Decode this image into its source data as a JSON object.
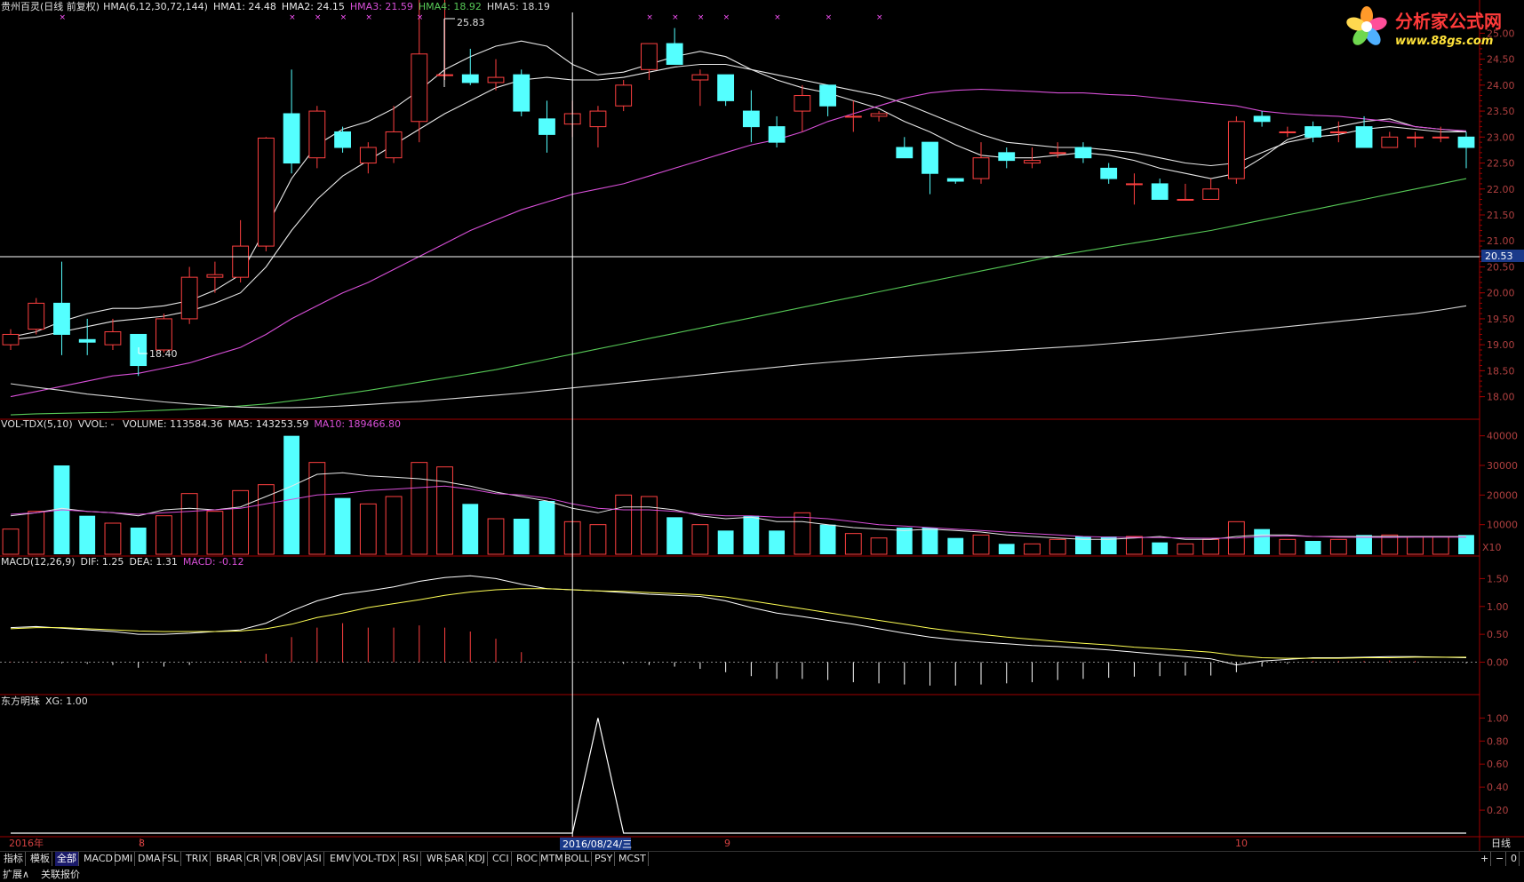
{
  "colors": {
    "bg": "#000000",
    "up": "#ff4040",
    "down": "#54ffff",
    "frame": "#a00000",
    "axis_text": "#b04040",
    "white": "#ffffff",
    "yellow": "#ffff54",
    "magenta": "#ff54ff",
    "green": "#54ff54",
    "hma1": "#e8e8e8",
    "hma2": "#e8e8e8",
    "hma3": "#d84fd8",
    "hma4": "#56c856",
    "hma5": "#d8d8d8",
    "vol_ma5": "#e8e8e8",
    "vol_ma10": "#d84fd8"
  },
  "header": {
    "stock": "贵州百灵(日线 前复权)",
    "indicator": "HMA(6,12,30,72,144)",
    "hma1": "HMA1: 24.48",
    "hma2": "HMA2: 24.15",
    "hma3": "HMA3: 21.59",
    "hma4": "HMA4: 18.92",
    "hma5": "HMA5: 18.19"
  },
  "vol_header": {
    "name": "VOL-TDX(5,10)",
    "vvol": "VVOL: -",
    "volume": "VOLUME: 113584.36",
    "ma5": "MA5: 143253.59",
    "ma10": "MA10: 189466.80"
  },
  "macd_header": {
    "name": "MACD(12,26,9)",
    "dif": "DIF: 1.25",
    "dea": "DEA: 1.31",
    "macd": "MACD: -0.12"
  },
  "xg_header": {
    "name": "东方明珠",
    "xg": "XG: 1.00"
  },
  "logo": {
    "title": "分析家公式网",
    "url": "www.88gs.com"
  },
  "price_annotations": {
    "high": "25.83",
    "low": "18.40",
    "current": "20.53"
  },
  "price_axis": [
    "25.00",
    "24.50",
    "24.00",
    "23.50",
    "23.00",
    "22.50",
    "22.00",
    "21.50",
    "21.00",
    "20.50",
    "20.00",
    "19.50",
    "19.00",
    "18.50",
    "18.00"
  ],
  "vol_axis": [
    "40000",
    "30000",
    "20000",
    "10000"
  ],
  "vol_unit": "X10",
  "macd_axis": [
    "1.50",
    "1.00",
    "0.50",
    "0.00"
  ],
  "xg_axis": [
    "1.00",
    "0.80",
    "0.60",
    "0.40",
    "0.20"
  ],
  "date_labels": {
    "year": "2016年",
    "m8": "8",
    "cursor": "2016/08/24/三",
    "m9": "9",
    "m10": "10",
    "period": "日线"
  },
  "tabs": [
    "指标",
    "模板",
    "全部",
    "MACD",
    "DMI",
    "DMA",
    "FSL",
    "TRIX",
    "BRAR",
    "CR",
    "VR",
    "OBV",
    "ASI",
    "EMV",
    "VOL-TDX",
    "RSI",
    "WR",
    "SAR",
    "KDJ",
    "CCI",
    "ROC",
    "MTM",
    "BOLL",
    "PSY",
    "MCST"
  ],
  "tab_controls": [
    "+",
    "−",
    "0"
  ],
  "bottom": {
    "expand": "扩展∧",
    "linked": "关联报价"
  },
  "chart_data": {
    "type": "candlestick",
    "price_range": [
      17.6,
      25.4
    ],
    "candles": [
      {
        "o": 19.0,
        "c": 19.2,
        "h": 19.3,
        "l": 18.9
      },
      {
        "o": 19.3,
        "c": 19.8,
        "h": 19.9,
        "l": 19.2
      },
      {
        "o": 19.8,
        "c": 19.2,
        "h": 20.6,
        "l": 18.8
      },
      {
        "o": 19.1,
        "c": 19.05,
        "h": 19.5,
        "l": 18.8
      },
      {
        "o": 19.0,
        "c": 19.25,
        "h": 19.5,
        "l": 18.9
      },
      {
        "o": 19.2,
        "c": 18.6,
        "h": 19.2,
        "l": 18.4
      },
      {
        "o": 18.9,
        "c": 19.5,
        "h": 19.6,
        "l": 18.85
      },
      {
        "o": 19.5,
        "c": 20.3,
        "h": 20.5,
        "l": 19.4
      },
      {
        "o": 20.3,
        "c": 20.35,
        "h": 20.6,
        "l": 20.0
      },
      {
        "o": 20.3,
        "c": 20.9,
        "h": 21.4,
        "l": 20.2
      },
      {
        "o": 20.9,
        "c": 22.98,
        "h": 23.0,
        "l": 20.8
      },
      {
        "o": 23.45,
        "c": 22.5,
        "h": 24.3,
        "l": 22.3
      },
      {
        "o": 22.6,
        "c": 23.5,
        "h": 23.6,
        "l": 22.4
      },
      {
        "o": 23.1,
        "c": 22.8,
        "h": 23.2,
        "l": 22.7
      },
      {
        "o": 22.5,
        "c": 22.8,
        "h": 22.9,
        "l": 22.3
      },
      {
        "o": 22.6,
        "c": 23.1,
        "h": 23.6,
        "l": 22.5
      },
      {
        "o": 23.3,
        "c": 24.6,
        "h": 25.7,
        "l": 22.9
      },
      {
        "o": 24.2,
        "c": 24.2,
        "h": 25.83,
        "l": 24.1
      },
      {
        "o": 24.2,
        "c": 24.05,
        "h": 24.7,
        "l": 24.0
      },
      {
        "o": 24.05,
        "c": 24.15,
        "h": 24.5,
        "l": 23.9
      },
      {
        "o": 24.2,
        "c": 23.5,
        "h": 24.3,
        "l": 23.4
      },
      {
        "o": 23.35,
        "c": 23.05,
        "h": 23.7,
        "l": 22.7
      },
      {
        "o": 23.25,
        "c": 23.45,
        "h": 23.7,
        "l": 23.0
      },
      {
        "o": 23.2,
        "c": 23.5,
        "h": 23.6,
        "l": 22.8
      },
      {
        "o": 23.6,
        "c": 24.0,
        "h": 24.1,
        "l": 23.5
      },
      {
        "o": 24.3,
        "c": 24.8,
        "h": 24.8,
        "l": 24.1
      },
      {
        "o": 24.8,
        "c": 24.4,
        "h": 25.1,
        "l": 24.4
      },
      {
        "o": 24.1,
        "c": 24.2,
        "h": 24.3,
        "l": 23.6
      },
      {
        "o": 24.2,
        "c": 23.7,
        "h": 24.2,
        "l": 23.6
      },
      {
        "o": 23.5,
        "c": 23.2,
        "h": 23.9,
        "l": 22.9
      },
      {
        "o": 23.2,
        "c": 22.9,
        "h": 23.4,
        "l": 22.8
      },
      {
        "o": 23.5,
        "c": 23.8,
        "h": 24.0,
        "l": 23.1
      },
      {
        "o": 24.0,
        "c": 23.6,
        "h": 24.0,
        "l": 23.4
      },
      {
        "o": 23.4,
        "c": 23.4,
        "h": 23.7,
        "l": 23.1
      },
      {
        "o": 23.4,
        "c": 23.45,
        "h": 23.5,
        "l": 23.3
      },
      {
        "o": 22.8,
        "c": 22.6,
        "h": 23.0,
        "l": 22.6
      },
      {
        "o": 22.9,
        "c": 22.3,
        "h": 22.9,
        "l": 21.9
      },
      {
        "o": 22.2,
        "c": 22.15,
        "h": 22.2,
        "l": 22.1
      },
      {
        "o": 22.2,
        "c": 22.6,
        "h": 22.9,
        "l": 22.1
      },
      {
        "o": 22.7,
        "c": 22.55,
        "h": 22.8,
        "l": 22.4
      },
      {
        "o": 22.5,
        "c": 22.55,
        "h": 22.8,
        "l": 22.4
      },
      {
        "o": 22.7,
        "c": 22.7,
        "h": 22.9,
        "l": 22.6
      },
      {
        "o": 22.8,
        "c": 22.6,
        "h": 22.9,
        "l": 22.5
      },
      {
        "o": 22.4,
        "c": 22.2,
        "h": 22.5,
        "l": 22.1
      },
      {
        "o": 22.1,
        "c": 22.1,
        "h": 22.3,
        "l": 21.7
      },
      {
        "o": 22.1,
        "c": 21.8,
        "h": 22.2,
        "l": 21.8
      },
      {
        "o": 21.8,
        "c": 21.8,
        "h": 22.1,
        "l": 21.8
      },
      {
        "o": 21.8,
        "c": 22.0,
        "h": 22.2,
        "l": 21.8
      },
      {
        "o": 22.2,
        "c": 23.3,
        "h": 23.4,
        "l": 22.1
      },
      {
        "o": 23.4,
        "c": 23.3,
        "h": 23.5,
        "l": 23.2
      },
      {
        "o": 23.1,
        "c": 23.1,
        "h": 23.2,
        "l": 23.0
      },
      {
        "o": 23.2,
        "c": 23.0,
        "h": 23.3,
        "l": 22.9
      },
      {
        "o": 23.1,
        "c": 23.1,
        "h": 23.3,
        "l": 22.9
      },
      {
        "o": 23.2,
        "c": 22.8,
        "h": 23.4,
        "l": 22.8
      },
      {
        "o": 22.8,
        "c": 23.0,
        "h": 23.1,
        "l": 22.8
      },
      {
        "o": 23.0,
        "c": 23.0,
        "h": 23.1,
        "l": 22.8
      },
      {
        "o": 23.0,
        "c": 23.0,
        "h": 23.2,
        "l": 22.9
      },
      {
        "o": 23.0,
        "c": 22.8,
        "h": 23.1,
        "l": 22.4
      }
    ],
    "hma_series": [
      {
        "values": [
          19.15,
          19.25,
          19.45,
          19.6,
          19.7,
          19.7,
          19.75,
          19.85,
          20.05,
          20.35,
          21.25,
          22.2,
          22.85,
          23.15,
          23.3,
          23.55,
          23.9,
          24.3,
          24.55,
          24.75,
          24.85,
          24.75,
          24.4,
          24.2,
          24.25,
          24.4,
          24.55,
          24.65,
          24.55,
          24.3,
          24.1,
          23.95,
          23.85,
          23.7,
          23.55,
          23.3,
          23.1,
          22.85,
          22.65,
          22.6,
          22.6,
          22.65,
          22.7,
          22.65,
          22.55,
          22.4,
          22.3,
          22.2,
          22.3,
          22.6,
          22.95,
          23.1,
          23.2,
          23.3,
          23.35,
          23.2,
          23.15,
          23.1
        ]
      },
      {
        "values": [
          19.1,
          19.15,
          19.25,
          19.35,
          19.45,
          19.5,
          19.55,
          19.65,
          19.8,
          20.0,
          20.5,
          21.2,
          21.8,
          22.25,
          22.55,
          22.85,
          23.15,
          23.45,
          23.7,
          23.95,
          24.1,
          24.15,
          24.1,
          24.1,
          24.15,
          24.25,
          24.35,
          24.4,
          24.4,
          24.3,
          24.2,
          24.1,
          24.0,
          23.9,
          23.8,
          23.65,
          23.45,
          23.25,
          23.05,
          22.9,
          22.85,
          22.8,
          22.8,
          22.75,
          22.7,
          22.6,
          22.5,
          22.45,
          22.5,
          22.7,
          22.9,
          23.0,
          23.05,
          23.15,
          23.2,
          23.15,
          23.1,
          23.1
        ]
      },
      {
        "values": [
          18.0,
          18.1,
          18.2,
          18.3,
          18.4,
          18.45,
          18.55,
          18.65,
          18.8,
          18.95,
          19.2,
          19.5,
          19.75,
          20.0,
          20.2,
          20.45,
          20.7,
          20.95,
          21.2,
          21.4,
          21.6,
          21.75,
          21.9,
          22.0,
          22.1,
          22.25,
          22.4,
          22.55,
          22.7,
          22.85,
          22.95,
          23.1,
          23.3,
          23.45,
          23.6,
          23.75,
          23.85,
          23.9,
          23.92,
          23.9,
          23.88,
          23.85,
          23.85,
          23.82,
          23.8,
          23.75,
          23.7,
          23.65,
          23.6,
          23.5,
          23.45,
          23.42,
          23.4,
          23.35,
          23.3,
          23.2,
          23.15,
          23.12
        ]
      },
      {
        "values": [
          17.65,
          17.67,
          17.68,
          17.69,
          17.7,
          17.72,
          17.74,
          17.76,
          17.79,
          17.82,
          17.86,
          17.92,
          17.98,
          18.05,
          18.12,
          18.2,
          18.28,
          18.36,
          18.44,
          18.52,
          18.62,
          18.72,
          18.82,
          18.92,
          19.02,
          19.12,
          19.22,
          19.32,
          19.42,
          19.52,
          19.62,
          19.72,
          19.82,
          19.92,
          20.02,
          20.12,
          20.22,
          20.32,
          20.42,
          20.52,
          20.62,
          20.72,
          20.8,
          20.88,
          20.96,
          21.04,
          21.12,
          21.2,
          21.3,
          21.4,
          21.5,
          21.6,
          21.7,
          21.8,
          21.9,
          22.0,
          22.1,
          22.2
        ]
      },
      {
        "values": [
          18.25,
          18.18,
          18.12,
          18.05,
          18.0,
          17.95,
          17.9,
          17.86,
          17.83,
          17.8,
          17.79,
          17.79,
          17.8,
          17.82,
          17.85,
          17.88,
          17.91,
          17.95,
          17.99,
          18.03,
          18.07,
          18.12,
          18.17,
          18.22,
          18.27,
          18.32,
          18.37,
          18.42,
          18.47,
          18.52,
          18.57,
          18.62,
          18.66,
          18.7,
          18.74,
          18.77,
          18.8,
          18.83,
          18.86,
          18.89,
          18.92,
          18.95,
          18.98,
          19.02,
          19.06,
          19.1,
          19.15,
          19.2,
          19.25,
          19.3,
          19.35,
          19.4,
          19.45,
          19.5,
          19.55,
          19.6,
          19.67,
          19.75
        ]
      }
    ],
    "volume": {
      "range": [
        0,
        42000
      ],
      "values": [
        8500,
        14500,
        30000,
        13000,
        10500,
        9000,
        13000,
        20500,
        14500,
        21500,
        23500,
        40000,
        31000,
        19000,
        17000,
        19500,
        31000,
        29500,
        17000,
        12000,
        12000,
        18000,
        11000,
        10000,
        20000,
        19500,
        12500,
        10000,
        8000,
        13000,
        8000,
        14000,
        10000,
        7000,
        5500,
        9000,
        9000,
        5500,
        6500,
        3500,
        3500,
        5000,
        6000,
        6000,
        6000,
        4000,
        3500,
        5000,
        11000,
        8500,
        5000,
        4500,
        5000,
        6500,
        6500,
        6000,
        6000,
        6500
      ],
      "ma5": [
        13000,
        14000,
        15500,
        14500,
        14000,
        13000,
        15000,
        15500,
        15000,
        16000,
        19500,
        23000,
        27000,
        27500,
        26500,
        26000,
        25500,
        24500,
        23000,
        21000,
        19500,
        18000,
        15500,
        14000,
        16000,
        16000,
        15000,
        13000,
        12000,
        12500,
        11000,
        11000,
        10000,
        9000,
        8500,
        8000,
        8500,
        8000,
        7500,
        6500,
        6000,
        5500,
        5000,
        5000,
        5500,
        6000,
        5000,
        5000,
        6000,
        6500,
        6500,
        6000,
        6000,
        6000,
        6000,
        6000,
        6000,
        6000
      ],
      "ma10": [
        13500,
        14000,
        15000,
        14500,
        14000,
        13500,
        14000,
        14500,
        15000,
        15500,
        17000,
        18500,
        20000,
        20500,
        21500,
        22000,
        22500,
        23000,
        22000,
        20500,
        20000,
        19000,
        17000,
        15500,
        15000,
        15000,
        14500,
        13500,
        13000,
        13000,
        12500,
        12500,
        12000,
        11000,
        10000,
        9500,
        9000,
        8500,
        8000,
        7500,
        7000,
        6500,
        6000,
        5800,
        5700,
        5600,
        5500,
        5400,
        5500,
        6000,
        6200,
        6000,
        5800,
        5700,
        5700,
        5800,
        5800,
        5800
      ]
    },
    "macd": {
      "range": [
        -0.55,
        1.65
      ],
      "dif": [
        0.62,
        0.64,
        0.61,
        0.58,
        0.55,
        0.5,
        0.5,
        0.52,
        0.55,
        0.58,
        0.7,
        0.92,
        1.1,
        1.22,
        1.28,
        1.35,
        1.45,
        1.52,
        1.55,
        1.5,
        1.4,
        1.32,
        1.3,
        1.28,
        1.25,
        1.22,
        1.2,
        1.18,
        1.1,
        0.98,
        0.88,
        0.82,
        0.75,
        0.68,
        0.6,
        0.52,
        0.45,
        0.4,
        0.36,
        0.33,
        0.3,
        0.28,
        0.25,
        0.22,
        0.18,
        0.14,
        0.1,
        0.06,
        -0.05,
        0.02,
        0.05,
        0.08,
        0.08,
        0.09,
        0.1,
        0.1,
        0.09,
        0.08
      ],
      "dea": [
        0.6,
        0.62,
        0.62,
        0.6,
        0.58,
        0.56,
        0.55,
        0.55,
        0.55,
        0.56,
        0.6,
        0.68,
        0.8,
        0.88,
        0.98,
        1.05,
        1.12,
        1.2,
        1.26,
        1.3,
        1.32,
        1.32,
        1.3,
        1.28,
        1.27,
        1.25,
        1.23,
        1.21,
        1.17,
        1.1,
        1.03,
        0.96,
        0.89,
        0.82,
        0.75,
        0.68,
        0.61,
        0.55,
        0.5,
        0.45,
        0.41,
        0.37,
        0.34,
        0.31,
        0.27,
        0.24,
        0.21,
        0.18,
        0.12,
        0.08,
        0.07,
        0.07,
        0.07,
        0.08,
        0.08,
        0.09,
        0.09,
        0.09
      ],
      "hist": [
        0.01,
        0.01,
        -0.02,
        -0.03,
        -0.05,
        -0.1,
        -0.08,
        -0.05,
        0.0,
        0.02,
        0.15,
        0.45,
        0.62,
        0.7,
        0.62,
        0.62,
        0.66,
        0.62,
        0.55,
        0.42,
        0.18,
        0.0,
        0.0,
        0.0,
        -0.03,
        -0.05,
        -0.08,
        -0.12,
        -0.18,
        -0.25,
        -0.3,
        -0.3,
        -0.32,
        -0.36,
        -0.38,
        -0.4,
        -0.42,
        -0.42,
        -0.4,
        -0.38,
        -0.36,
        -0.32,
        -0.3,
        -0.28,
        -0.26,
        -0.25,
        -0.24,
        -0.24,
        -0.18,
        -0.08,
        -0.03,
        0.02,
        0.02,
        0.02,
        0.03,
        0.02,
        0.0,
        -0.02
      ]
    },
    "xg": {
      "range": [
        0,
        1.08
      ],
      "values": [
        0,
        0,
        0,
        0,
        0,
        0,
        0,
        0,
        0,
        0,
        0,
        0,
        0,
        0,
        0,
        0,
        0,
        0,
        0,
        0,
        0,
        0,
        0.0,
        1.0,
        0,
        0,
        0,
        0,
        0,
        0,
        0,
        0,
        0,
        0,
        0,
        0,
        0,
        0,
        0,
        0,
        0,
        0,
        0,
        0,
        0,
        0,
        0,
        0,
        0,
        0,
        0,
        0,
        0,
        0,
        0,
        0,
        0,
        0
      ]
    },
    "cursor_index": 22
  }
}
